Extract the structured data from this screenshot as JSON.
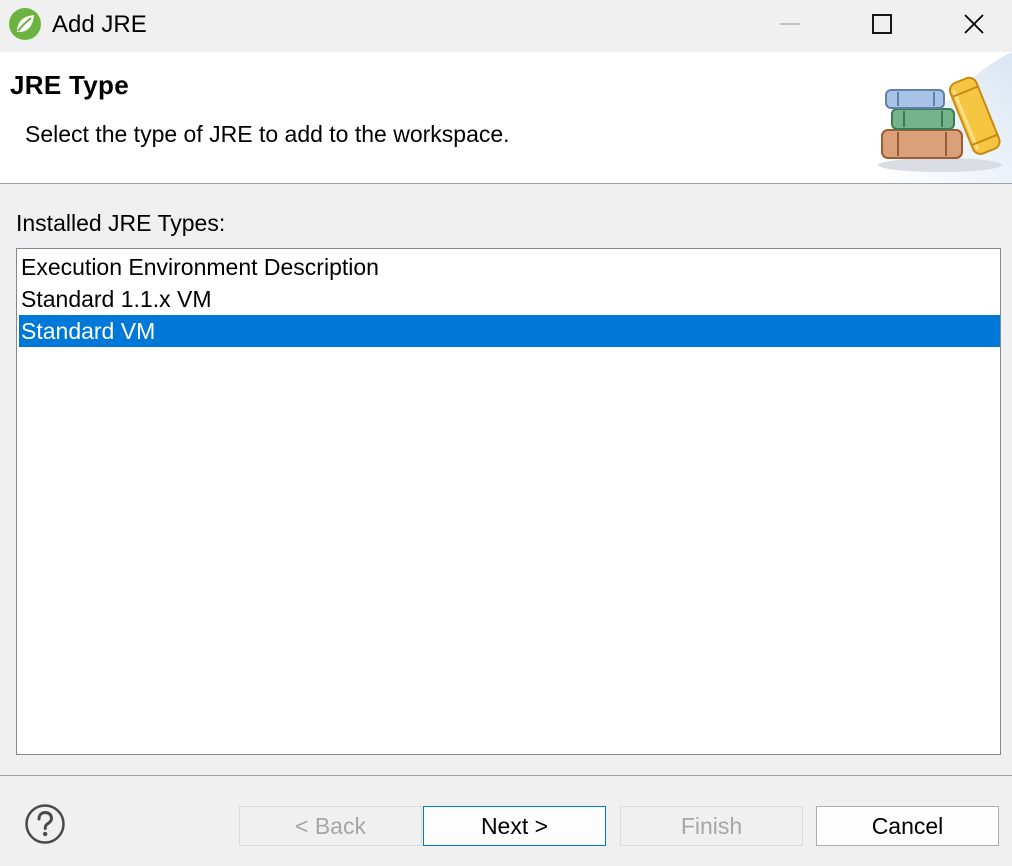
{
  "window": {
    "title": "Add JRE",
    "app_icon": "spring-leaf-icon",
    "controls": [
      "minimize-icon",
      "maximize-icon",
      "close-icon"
    ]
  },
  "banner": {
    "title": "JRE Type",
    "description": "Select the type of JRE to add to the workspace.",
    "art": "library-books-icon"
  },
  "list": {
    "label": "Installed JRE Types:",
    "items": [
      {
        "label": "Execution Environment Description",
        "selected": false
      },
      {
        "label": "Standard 1.1.x VM",
        "selected": false
      },
      {
        "label": "Standard VM",
        "selected": true
      }
    ]
  },
  "buttons": {
    "back": {
      "label": "< Back",
      "enabled": false
    },
    "next": {
      "label": "Next >",
      "enabled": true
    },
    "finish": {
      "label": "Finish",
      "enabled": false
    },
    "cancel": {
      "label": "Cancel",
      "enabled": true
    }
  },
  "help": {
    "icon": "help-question-icon"
  },
  "colors": {
    "selection": "#0078d7",
    "disabled_text": "#a6a6a6",
    "app_icon_green": "#6db33f"
  }
}
